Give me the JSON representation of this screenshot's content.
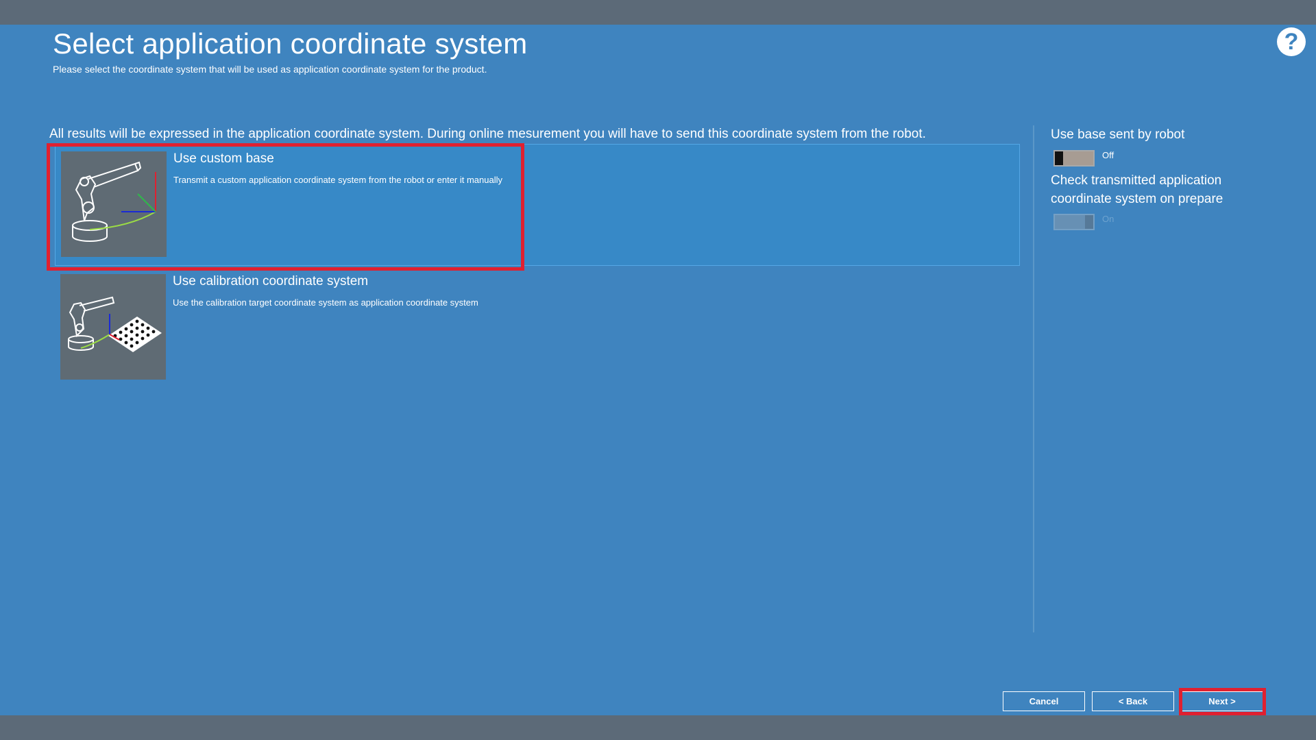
{
  "header": {
    "title": "Select application coordinate system",
    "subtitle": "Please select the coordinate system that will be used as application coordinate system for the product."
  },
  "info_text": "All results will be expressed in the application coordinate system. During online mesurement you will have to send this coordinate system from the robot.",
  "options": [
    {
      "title": "Use custom base",
      "description": "Transmit a custom application coordinate system from the robot or enter it manually",
      "selected": true,
      "icon": "robot-custom-base-icon"
    },
    {
      "title": "Use calibration coordinate system",
      "description": "Use the calibration target coordinate system as application coordinate system",
      "selected": false,
      "icon": "robot-calibration-plate-icon"
    }
  ],
  "side_panel": {
    "use_base_label": "Use base sent by robot",
    "use_base_state": "Off",
    "check_label": "Check transmitted application coordinate system on prepare",
    "check_state": "On"
  },
  "footer": {
    "cancel_label": "Cancel",
    "back_label": "< Back",
    "next_label": "Next >"
  },
  "colors": {
    "background": "#3f84bf",
    "bar": "#5c6a78",
    "selected_option": "#3789c7",
    "highlight": "#e02030"
  }
}
